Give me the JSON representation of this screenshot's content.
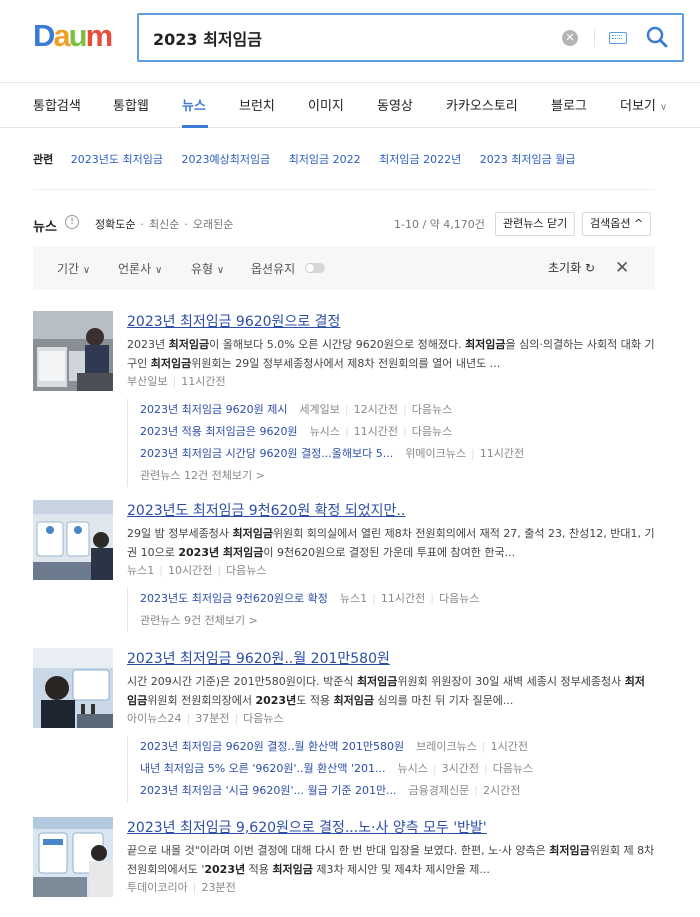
{
  "logo": {
    "letters": [
      "D",
      "a",
      "u",
      "m"
    ],
    "colors": [
      "#3a7bd5",
      "#f0a028",
      "#7bc043",
      "#e84e3c"
    ]
  },
  "search": {
    "query": "2023 최저임금"
  },
  "tabs": [
    {
      "label": "통합검색"
    },
    {
      "label": "통합웹"
    },
    {
      "label": "뉴스"
    },
    {
      "label": "브런치"
    },
    {
      "label": "이미지"
    },
    {
      "label": "동영상"
    },
    {
      "label": "카카오스토리"
    },
    {
      "label": "블로그"
    },
    {
      "label": "더보기"
    }
  ],
  "related": {
    "label": "관련",
    "items": [
      "2023년도 최저임금",
      "2023예상최저임금",
      "최저임금 2022",
      "최저임금 2022년",
      "2023 최저임금 월급"
    ]
  },
  "newsbar": {
    "title": "뉴스",
    "sort": [
      "정확도순",
      "최신순",
      "오래된순"
    ],
    "count": "1-10 / 약 4,170건",
    "related_toggle": "관련뉴스 닫기",
    "options": "검색옵션"
  },
  "filters": {
    "period": "기간",
    "press": "언론사",
    "type": "유형",
    "keep": "옵션유지",
    "reset": "초기화"
  },
  "items": [
    {
      "headline": "2023년 최저임금 9620원으로 결정",
      "desc_parts": [
        [
          "2023년 ",
          false
        ],
        [
          "최저임금",
          true
        ],
        [
          "이 올해보다 5.0% 오른 시간당 9620원으로 정해졌다. ",
          false
        ],
        [
          "최저임금",
          true
        ],
        [
          "을 심의·의결하는 사회적 대화 기구인 ",
          false
        ],
        [
          "최저임금",
          true
        ],
        [
          "위원회는 29일 정부세종청사에서 제8차 전원회의를 열어 내년도 ...",
          false
        ]
      ],
      "source": "부산일보",
      "time": "11시간전",
      "subs": [
        {
          "title": "2023년 최저임금 9620원 제시",
          "source": "세계일보",
          "time": "12시간전",
          "via": "다음뉴스"
        },
        {
          "title": "2023년 적용 최저임금은 9620원",
          "source": "뉴시스",
          "time": "11시간전",
          "via": "다음뉴스"
        },
        {
          "title": "2023년 최저임금 시간당 9620원 결정...올해보다 5...",
          "source": "위메이크뉴스",
          "time": "11시간전",
          "via": ""
        }
      ],
      "seeall": "관련뉴스 12건 전체보기 >"
    },
    {
      "headline": "2023년도 최저임금 9천620원 확정 되었지만..",
      "desc_parts": [
        [
          "29일 밤 정부세종청사 ",
          false
        ],
        [
          "최저임금",
          true
        ],
        [
          "위원회 회의실에서 열린 제8차 전원회의에서 재적 27, 출석 23, 찬성12, 반대1, 기권 10으로 ",
          false
        ],
        [
          "2023년 최저임금",
          true
        ],
        [
          "이 9천620원으로 결정된 가운데 투표에 참여한 한국...",
          false
        ]
      ],
      "source": "뉴스1",
      "time": "10시간전",
      "via": "다음뉴스",
      "subs": [
        {
          "title": "2023년도 최저임금 9천620원으로 확정",
          "source": "뉴스1",
          "time": "11시간전",
          "via": "다음뉴스"
        }
      ],
      "seeall": "관련뉴스 9건 전체보기 >"
    },
    {
      "headline": "2023년 최저임금 9620원..월 201만580원",
      "desc_parts": [
        [
          "시간 209시간 기준)은 201만580원이다. 박준식 ",
          false
        ],
        [
          "최저임금",
          true
        ],
        [
          "위원회 위원장이 30일 새벽 세종시 정부세종청사 ",
          false
        ],
        [
          "최저임금",
          true
        ],
        [
          "위원회 전원회의장에서 ",
          false
        ],
        [
          "2023년",
          true
        ],
        [
          "도 적용 ",
          false
        ],
        [
          "최저임금",
          true
        ],
        [
          " 심의를 마친 뒤 기자 질문에...",
          false
        ]
      ],
      "source": "아이뉴스24",
      "time": "37분전",
      "via": "다음뉴스",
      "subs": [
        {
          "title": "2023년 최저임금 9620원 결정..월 환산액 201만580원",
          "source": "브레이크뉴스",
          "time": "1시간전",
          "via": ""
        },
        {
          "title": "내년 최저임금 5% 오른 '9620원'..월 환산액 '201...",
          "source": "뉴시스",
          "time": "3시간전",
          "via": "다음뉴스"
        },
        {
          "title": "2023년 최저임금 '시급 9620원'... 월급 기준 201만...",
          "source": "금융경제신문",
          "time": "2시간전",
          "via": ""
        }
      ]
    },
    {
      "headline": "2023년 최저임금 9,620원으로 결정...노·사 양측 모두 '반발'",
      "desc_parts": [
        [
          "끝으로 내몰 것\"이라며 이번 결정에 대해 다시 한 번 반대 입장을 보였다. 한편, 노·사 양측은 ",
          false
        ],
        [
          "최저임금",
          true
        ],
        [
          "위원회 제 8차 전원회의에서도 '",
          false
        ],
        [
          "2023년",
          true
        ],
        [
          " 적용 ",
          false
        ],
        [
          "최저임금",
          true
        ],
        [
          " 제3차 제시안 및 제4차 제시안을 제...",
          false
        ]
      ],
      "source": "투데이코리아",
      "time": "23분전"
    }
  ]
}
